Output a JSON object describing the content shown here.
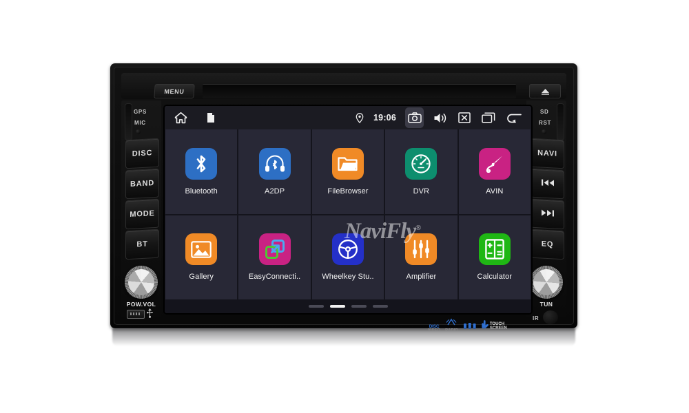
{
  "device": {
    "brand_watermark": "NaviFly",
    "brand_watermark_mark": "®",
    "top_bezel": {
      "menu_label": "MENU",
      "eject_icon": "eject-icon"
    },
    "left_panel": {
      "gps_label": "GPS",
      "mic_label": "MIC",
      "buttons": [
        {
          "label": "DISC",
          "name": "disc-button"
        },
        {
          "label": "BAND",
          "name": "band-button"
        },
        {
          "label": "MODE",
          "name": "mode-button"
        },
        {
          "label": "BT",
          "name": "bt-button"
        }
      ],
      "knob_label": "POW.VOL",
      "usb_icon": "usb-icon"
    },
    "right_panel": {
      "sd_label": "SD",
      "rst_label": "RST",
      "buttons": [
        {
          "label": "NAVI",
          "name": "navi-button",
          "icon": ""
        },
        {
          "label": "",
          "name": "previous-track-button",
          "icon": "previous-track-icon"
        },
        {
          "label": "",
          "name": "next-track-button",
          "icon": "next-track-icon"
        },
        {
          "label": "EQ",
          "name": "eq-button",
          "icon": ""
        }
      ],
      "knob_label": "TUN",
      "ir_label": "IR"
    },
    "badges": [
      {
        "top": "DISC",
        "bottom": "VIDEO",
        "name": "disc-video-badge"
      },
      {
        "top": "",
        "bottom": "RADIO",
        "name": "radio-badge"
      },
      {
        "top": "",
        "bottom": "",
        "name": "bluetooth-badge"
      },
      {
        "top": "TOUCH",
        "bottom": "SCREEN",
        "name": "touch-screen-badge"
      }
    ]
  },
  "screen": {
    "statusbar": {
      "left_icons": [
        {
          "name": "home-icon",
          "glyph": "home"
        },
        {
          "name": "file-icon",
          "glyph": "file"
        }
      ],
      "location_icon": "location-pin-icon",
      "time": "19:06",
      "right_icons": [
        {
          "name": "camera-icon",
          "glyph": "camera",
          "active": true
        },
        {
          "name": "volume-icon",
          "glyph": "volume",
          "active": false
        },
        {
          "name": "close-icon",
          "glyph": "close-box",
          "active": false
        },
        {
          "name": "recent-apps-icon",
          "glyph": "recents",
          "active": false
        },
        {
          "name": "back-icon",
          "glyph": "back",
          "active": false
        }
      ]
    },
    "apps": [
      {
        "label": "Bluetooth",
        "icon": "bluetooth-icon",
        "color": "#2d6fc4"
      },
      {
        "label": "A2DP",
        "icon": "headphones-icon",
        "color": "#2d6fc4"
      },
      {
        "label": "FileBrowser",
        "icon": "folder-icon",
        "color": "#f08a26"
      },
      {
        "label": "DVR",
        "icon": "speedometer-icon",
        "color": "#0d8e6e"
      },
      {
        "label": "AVIN",
        "icon": "audio-jack-icon",
        "color": "#c92283"
      },
      {
        "label": "Gallery",
        "icon": "image-icon",
        "color": "#f08a26"
      },
      {
        "label": "EasyConnecti..",
        "icon": "easyconnect-icon",
        "color": "#c92283"
      },
      {
        "label": "Wheelkey Stu..",
        "icon": "steering-wheel-icon",
        "color": "#2430c8"
      },
      {
        "label": "Amplifier",
        "icon": "equalizer-icon",
        "color": "#f08a26"
      },
      {
        "label": "Calculator",
        "icon": "calculator-icon",
        "color": "#1fb714"
      }
    ],
    "pager": {
      "count": 4,
      "active_index": 1
    }
  },
  "colors": {
    "screen_bg": "#282836",
    "screen_gap": "#14141c",
    "statusbar_bg": "#1b1b22",
    "active_highlight": "#3b3b47",
    "badge_blue": "#2f6fd0"
  }
}
